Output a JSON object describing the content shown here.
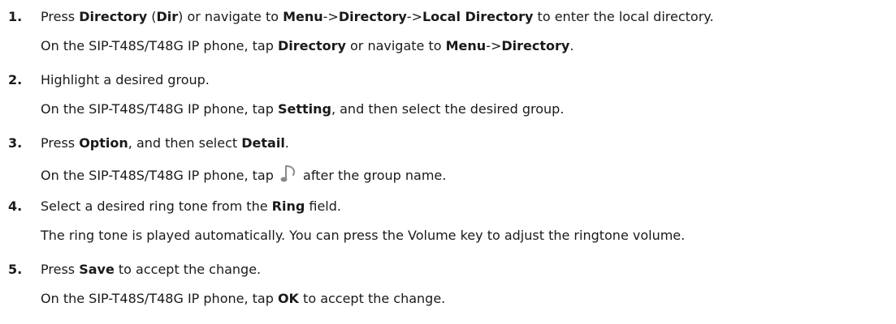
{
  "steps": [
    {
      "number": "1.",
      "line1": [
        {
          "t": "Press "
        },
        {
          "t": "Directory",
          "b": true
        },
        {
          "t": " ("
        },
        {
          "t": "Dir",
          "b": true
        },
        {
          "t": ") or navigate to "
        },
        {
          "t": "Menu",
          "b": true
        },
        {
          "t": "->"
        },
        {
          "t": "Directory",
          "b": true
        },
        {
          "t": "->"
        },
        {
          "t": "Local Directory",
          "b": true
        },
        {
          "t": " to enter the local directory."
        }
      ],
      "line2": [
        {
          "t": "On the SIP-T48S/T48G IP phone, tap "
        },
        {
          "t": "Directory",
          "b": true
        },
        {
          "t": " or navigate to "
        },
        {
          "t": "Menu",
          "b": true
        },
        {
          "t": "->"
        },
        {
          "t": "Directory",
          "b": true
        },
        {
          "t": "."
        }
      ]
    },
    {
      "number": "2.",
      "line1": [
        {
          "t": "Highlight a desired group."
        }
      ],
      "line2": [
        {
          "t": "On the SIP-T48S/T48G IP phone, tap "
        },
        {
          "t": "Setting",
          "b": true
        },
        {
          "t": ", and then select the desired group."
        }
      ]
    },
    {
      "number": "3.",
      "line1": [
        {
          "t": "Press "
        },
        {
          "t": "Option",
          "b": true
        },
        {
          "t": ", and then select "
        },
        {
          "t": "Detail",
          "b": true
        },
        {
          "t": "."
        }
      ],
      "line2": [
        {
          "t": "On the SIP-T48S/T48G IP phone, tap "
        },
        {
          "icon": "music-note-icon"
        },
        {
          "t": " after the group name."
        }
      ]
    },
    {
      "number": "4.",
      "line1": [
        {
          "t": "Select a desired ring tone from the "
        },
        {
          "t": "Ring",
          "b": true
        },
        {
          "t": " field."
        }
      ],
      "line2": [
        {
          "t": "The ring tone is played automatically. You can press the Volume key to adjust the ringtone volume."
        }
      ]
    },
    {
      "number": "5.",
      "line1": [
        {
          "t": "Press "
        },
        {
          "t": "Save",
          "b": true
        },
        {
          "t": " to accept the change."
        }
      ],
      "line2": [
        {
          "t": "On the SIP-T48S/T48G IP phone, tap "
        },
        {
          "t": "OK",
          "b": true
        },
        {
          "t": " to accept the change."
        }
      ]
    }
  ],
  "colors": {
    "text": "#1a1a1a",
    "icon": "#8a8a8a"
  }
}
